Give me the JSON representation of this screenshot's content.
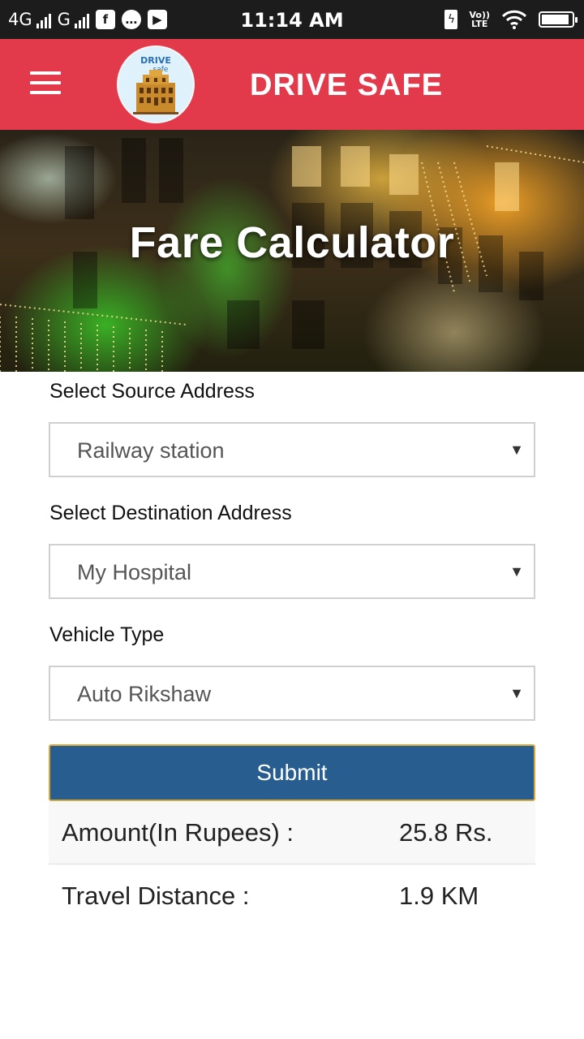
{
  "status_bar": {
    "network1": "4G",
    "network2": "G",
    "time": "11:14 AM",
    "volte_top": "Vo))",
    "volte_bottom": "LTE",
    "battery_level": 0.92
  },
  "app_bar": {
    "title": "DRIVE SAFE",
    "logo_text_1": "DRIVE",
    "logo_text_2": "safe"
  },
  "hero": {
    "title": "Fare Calculator"
  },
  "form": {
    "source_label": "Select Source Address",
    "source_value": "Railway station",
    "destination_label": "Select Destination Address",
    "destination_value": "My Hospital",
    "vehicle_label": "Vehicle Type",
    "vehicle_value": "Auto Rikshaw",
    "submit_label": "Submit"
  },
  "results": {
    "amount_label": "Amount(In Rupees) :",
    "amount_value": "25.8 Rs.",
    "distance_label": "Travel Distance :",
    "distance_value": "1.9 KM"
  },
  "colors": {
    "app_bar": "#e23a4b",
    "submit_button": "#285e8f",
    "submit_border": "#d7a73a"
  }
}
